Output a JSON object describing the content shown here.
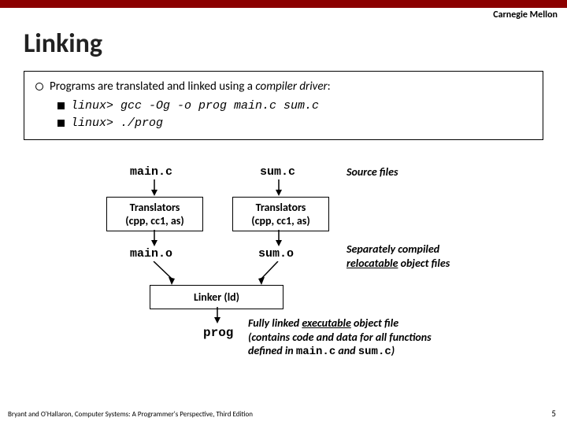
{
  "brand": "Carnegie Mellon",
  "title": "Linking",
  "bullet": {
    "main_pre": "Programs are translated and linked using a ",
    "main_em": "compiler driver",
    "main_post": ":",
    "cmd1": "linux> gcc -Og -o prog main.c sum.c",
    "cmd2": "linux> ./prog"
  },
  "diagram": {
    "src1": "main.c",
    "src2": "sum.c",
    "trans1_l1": "Translators",
    "trans1_l2": "(cpp, cc1, as)",
    "trans2_l1": "Translators",
    "trans2_l2": "(cpp, cc1, as)",
    "obj1": "main.o",
    "obj2": "sum.o",
    "linker": "Linker (ld)",
    "prog": "prog"
  },
  "annot": {
    "src": "Source files",
    "obj_a": "Separately compiled",
    "obj_b": "relocatable",
    "obj_c": " object files",
    "exe_a": "Fully linked ",
    "exe_b": "executable",
    "exe_c": " object file",
    "exe_d": "(contains code and data for all functions",
    "exe_e": "defined in ",
    "exe_f": "main.c",
    "exe_g": " and ",
    "exe_h": "sum.c",
    "exe_i": ")"
  },
  "footer": "Bryant and O'Hallaron, Computer Systems: A Programmer's Perspective, Third Edition",
  "page": "5"
}
